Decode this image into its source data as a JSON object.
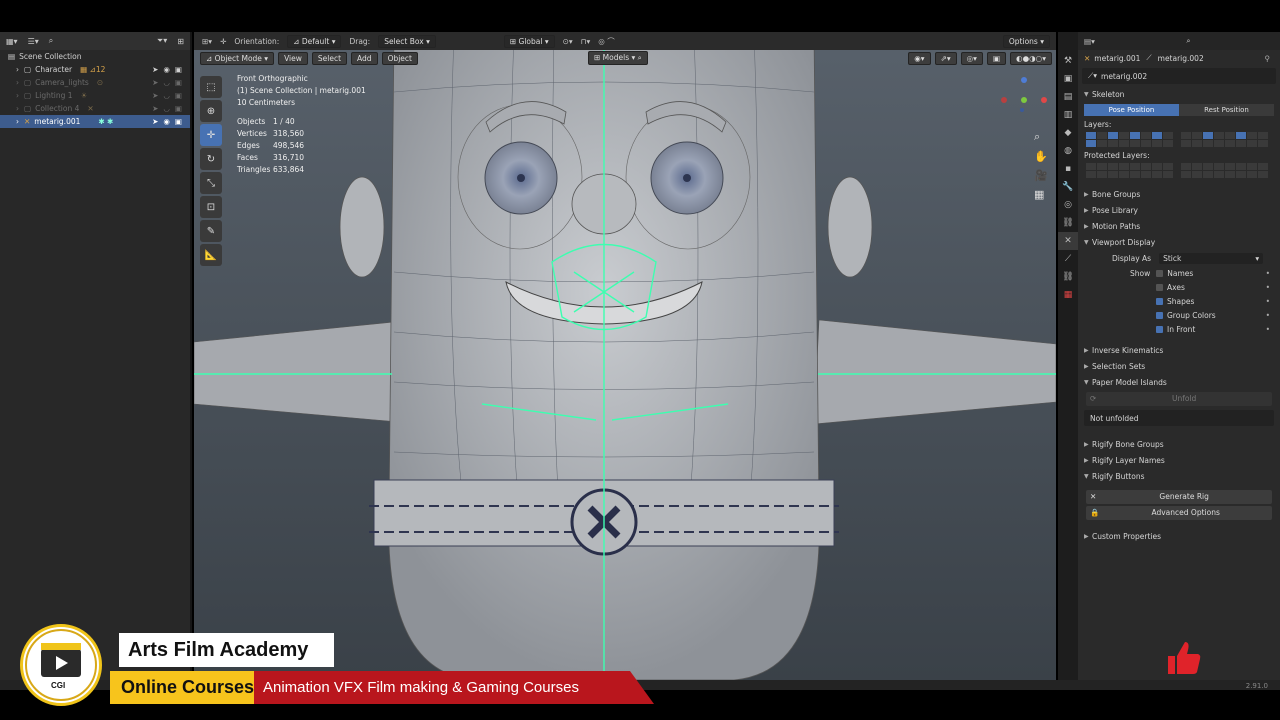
{
  "outliner": {
    "root": "Scene Collection",
    "items": [
      {
        "label": "Character",
        "state": "normal"
      },
      {
        "label": "Camera_lights",
        "state": "dim"
      },
      {
        "label": "Lighting 1",
        "state": "dim"
      },
      {
        "label": "Collection 4",
        "state": "dim"
      },
      {
        "label": "metarig.001",
        "state": "selected"
      }
    ]
  },
  "viewport": {
    "orientation_label": "Orientation:",
    "orientation_value": "Default",
    "drag_label": "Drag:",
    "drag_value": "Select Box",
    "transform": "Global",
    "options": "Options",
    "mode": "Object Mode",
    "menu": [
      "View",
      "Select",
      "Add",
      "Object"
    ],
    "collection_filter": "Models",
    "view_name": "Front Orthographic",
    "scene_path": "(1) Scene Collection | metarig.001",
    "scale": "10 Centimeters",
    "stats": [
      {
        "label": "Objects",
        "value": "1 / 40"
      },
      {
        "label": "Vertices",
        "value": "318,560"
      },
      {
        "label": "Edges",
        "value": "498,546"
      },
      {
        "label": "Faces",
        "value": "316,710"
      },
      {
        "label": "Triangles",
        "value": "633,864"
      }
    ]
  },
  "properties": {
    "header_object": "metarig.001",
    "header_data": "metarig.002",
    "datablock": "metarig.002",
    "skeleton": "Skeleton",
    "pose_position": "Pose Position",
    "rest_position": "Rest Position",
    "layers_label": "Layers:",
    "protected_layers_label": "Protected Layers:",
    "panels_top": [
      "Bone Groups",
      "Pose Library",
      "Motion Paths"
    ],
    "viewport_display": "Viewport Display",
    "display_as_label": "Display As",
    "display_as_value": "Stick",
    "show_label": "Show",
    "show_options": [
      {
        "label": "Names",
        "checked": false
      },
      {
        "label": "Axes",
        "checked": false
      },
      {
        "label": "Shapes",
        "checked": true
      },
      {
        "label": "Group Colors",
        "checked": true
      },
      {
        "label": "In Front",
        "checked": true
      }
    ],
    "panels_mid": [
      "Inverse Kinematics",
      "Selection Sets",
      "Paper Model Islands"
    ],
    "unfold_button": "Unfold",
    "not_unfolded": "Not unfolded",
    "panels_rigify": [
      "Rigify Bone Groups",
      "Rigify Layer Names",
      "Rigify Buttons"
    ],
    "generate_rig": "Generate Rig",
    "advanced_options": "Advanced Options",
    "custom_properties": "Custom Properties"
  },
  "status": {
    "version": "2.91.0"
  },
  "watermark": {
    "logo_text": "CGI",
    "academy": "Arts Film Academy",
    "courses": "Online Courses",
    "tagline": "Animation VFX Film making & Gaming Courses"
  },
  "colors": {
    "accent": "#4772b3",
    "bone": "#3dffb0",
    "brand_yellow": "#f7c41c",
    "brand_red": "#b9161d"
  }
}
